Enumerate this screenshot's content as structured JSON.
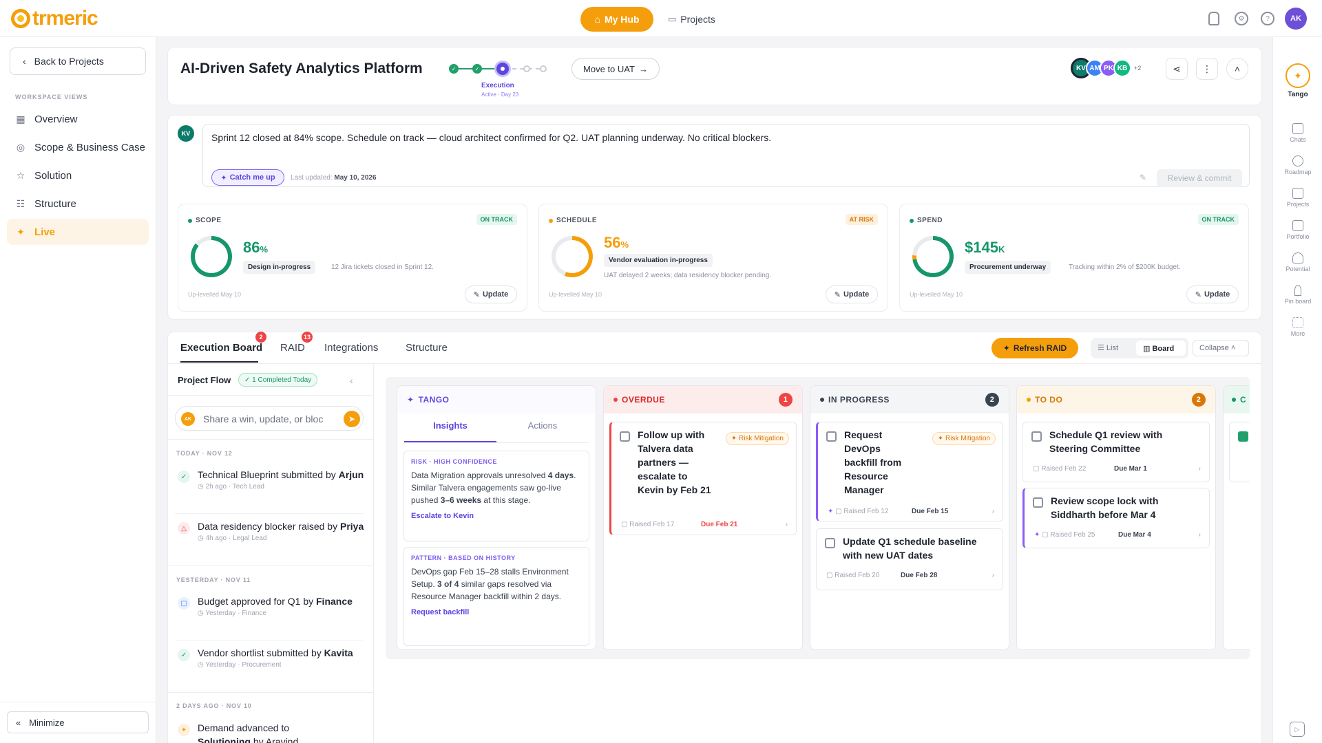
{
  "app": {
    "logo_text": "trmeric",
    "my_hub": "My Hub",
    "projects": "Projects",
    "user_initials": "AK"
  },
  "sidebar": {
    "back": "Back to Projects",
    "section_label": "WORKSPACE VIEWS",
    "items": [
      {
        "label": "Overview",
        "icon": "grid-icon"
      },
      {
        "label": "Scope & Business Case",
        "icon": "target-icon"
      },
      {
        "label": "Solution",
        "icon": "star-icon"
      },
      {
        "label": "Structure",
        "icon": "structure-icon"
      },
      {
        "label": "Live",
        "icon": "sparkle-icon"
      }
    ],
    "minimize": "Minimize"
  },
  "project": {
    "title": "AI-Driven Safety Analytics Platform",
    "stage": "Execution",
    "stage_sub": "Active · Day 23",
    "move_btn": "Move to UAT",
    "team": [
      "KV",
      "AM",
      "PK",
      "KB"
    ],
    "team_more": "+2"
  },
  "update": {
    "author": "KV",
    "message": "Sprint 12 closed at 84% scope. Schedule on track — cloud architect confirmed for Q2. UAT planning underway. No critical blockers.",
    "catch_me_up": "Catch me up",
    "last_updated_label": "Last updated:",
    "last_updated": "May 10, 2026",
    "review_commit": "Review & commit"
  },
  "metrics": [
    {
      "label": "SCOPE",
      "status": "ON TRACK",
      "value": "86",
      "unit": "%",
      "pill": "Design in-progress",
      "note": "12 Jira tickets closed in Sprint 12.",
      "footer": "Up-levelled May 10",
      "update": "Update",
      "fill": 0.86
    },
    {
      "label": "SCHEDULE",
      "status": "AT RISK",
      "value": "56",
      "unit": "%",
      "pill": "Vendor evaluation in-progress",
      "note": "UAT delayed 2 weeks; data residency blocker pending.",
      "footer": "Up-levelled May 10",
      "update": "Update",
      "fill": 0.56
    },
    {
      "label": "SPEND",
      "status": "ON TRACK",
      "value": "$145",
      "unit": "K",
      "pill": "Procurement underway",
      "note": "Tracking within 2% of $200K budget.",
      "footer": "Up-levelled May 10",
      "update": "Update",
      "fill": 0.725
    }
  ],
  "colors": {
    "accent": "#f59e0b",
    "green": "#16966b",
    "red": "#ef4444",
    "purple": "#7c5cf0"
  },
  "tabs": [
    {
      "label": "Execution Board",
      "badge": "2"
    },
    {
      "label": "RAID",
      "badge": "13"
    },
    {
      "label": "Integrations",
      "badge": ""
    },
    {
      "label": "Structure",
      "badge": ""
    }
  ],
  "toolbar": {
    "refresh": "Refresh RAID",
    "list": "List",
    "board": "Board",
    "collapse": "Collapse"
  },
  "flow": {
    "title": "Project Flow",
    "completed": "1 Completed Today",
    "placeholder": "Share a win, update, or bloc",
    "days": [
      "TODAY · NOV 12",
      "YESTERDAY · NOV 11",
      "2 DAYS AGO · NOV 10"
    ],
    "items": [
      {
        "text": "Technical Blueprint submitted by",
        "who": "Arjun",
        "meta": "2h ago · Tech Lead"
      },
      {
        "text": "Data residency blocker raised by",
        "who": "Priya",
        "meta": "4h ago · Legal Lead"
      },
      {
        "text": "Budget approved for Q1 by",
        "who": "Finance",
        "meta": "Yesterday · Finance"
      },
      {
        "text": "Vendor shortlist submitted by",
        "who": "Kavita",
        "meta": "Yesterday · Procurement"
      },
      {
        "text": "Demand advanced to",
        "who": "Solutioning",
        "by": " by Aravind",
        "meta": ""
      }
    ]
  },
  "board": {
    "tango": {
      "title": "TANGO",
      "tab_insights": "Insights",
      "tab_actions": "Actions",
      "insights": [
        {
          "label": "RISK · HIGH CONFIDENCE",
          "text_a": "Data Migration approvals unresolved ",
          "b1": "4 days",
          "text_b": ". Similar Talvera engagements saw go-live pushed ",
          "b2": "3–6 weeks",
          "text_c": " at this stage.",
          "link": "Escalate to Kevin"
        },
        {
          "label": "PATTERN · BASED ON HISTORY",
          "text_a": "DevOps gap Feb 15–28 stalls Environment Setup. ",
          "b1": "3 of 4",
          "text_b": " similar gaps resolved via Resource Manager backfill within 2 days.",
          "link": "Request backfill"
        }
      ]
    },
    "overdue": {
      "title": "OVERDUE",
      "count": "1",
      "tasks": [
        {
          "title": "Follow up with Talvera data partners — escalate to Kevin by Feb 21",
          "tag": "Risk Mitigation",
          "raised": "Raised Feb 17",
          "due": "Due Feb 21"
        }
      ]
    },
    "inprogress": {
      "title": "IN PROGRESS",
      "count": "2",
      "tasks": [
        {
          "title": "Request DevOps backfill from Resource Manager",
          "tag": "Risk Mitigation",
          "raised": "Raised Feb 12",
          "due": "Due Feb 15"
        },
        {
          "title": "Update Q1 schedule baseline with new UAT dates",
          "raised": "Raised Feb 20",
          "due": "Due Feb 28"
        }
      ]
    },
    "todo": {
      "title": "TO DO",
      "count": "2",
      "tasks": [
        {
          "title": "Schedule Q1 review with Steering Committee",
          "raised": "Raised Feb 22",
          "due": "Due Mar 1"
        },
        {
          "title": "Review scope lock with Siddharth before Mar 4",
          "raised": "Raised Feb 25",
          "due": "Due Mar 4"
        }
      ]
    },
    "completed_peek": "C"
  },
  "rail": {
    "tango": "Tango",
    "items": [
      "Chats",
      "Roadmap",
      "Projects",
      "Portfolio",
      "Potential",
      "Pin board",
      "More"
    ]
  }
}
